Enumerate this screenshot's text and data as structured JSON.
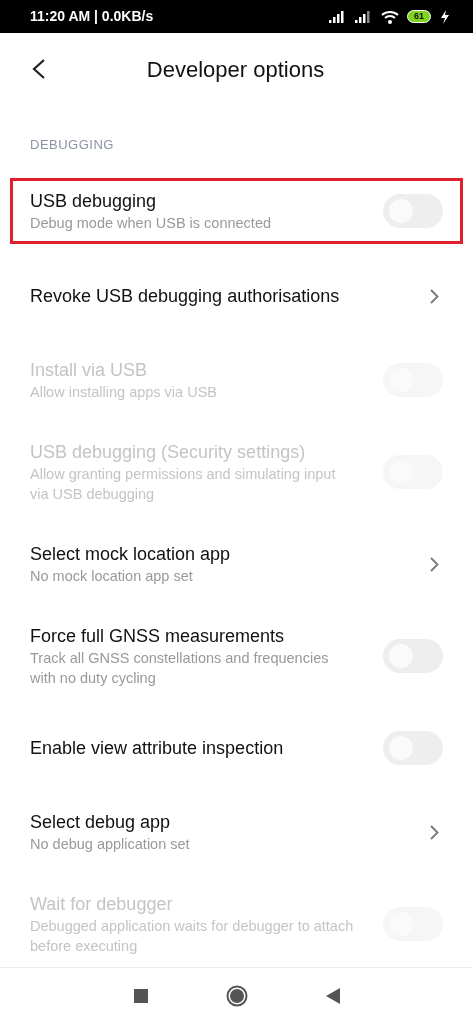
{
  "status_bar": {
    "time": "11:20 AM | 0.0KB/s",
    "battery": "61",
    "charging": true
  },
  "header": {
    "title": "Developer options"
  },
  "section": {
    "label": "DEBUGGING"
  },
  "items": [
    {
      "kind": "toggle",
      "title": "USB debugging",
      "subtitle": "Debug mode when USB is connected",
      "on": false,
      "disabled": false,
      "highlighted": true
    },
    {
      "kind": "link",
      "title": "Revoke USB debugging authorisations",
      "disabled": false,
      "highlighted": false
    },
    {
      "kind": "toggle",
      "title": "Install via USB",
      "subtitle": "Allow installing apps via USB",
      "on": false,
      "disabled": true,
      "highlighted": false
    },
    {
      "kind": "toggle",
      "title": "USB debugging (Security settings)",
      "subtitle": "Allow granting permissions and simulating input via USB debugging",
      "on": false,
      "disabled": true,
      "highlighted": false
    },
    {
      "kind": "link",
      "title": "Select mock location app",
      "subtitle": "No mock location app set",
      "disabled": false,
      "highlighted": false
    },
    {
      "kind": "toggle",
      "title": "Force full GNSS measurements",
      "subtitle": "Track all GNSS constellations and frequencies with no duty cycling",
      "on": false,
      "disabled": false,
      "highlighted": false
    },
    {
      "kind": "toggle",
      "title": "Enable view attribute inspection",
      "on": false,
      "disabled": false,
      "highlighted": false
    },
    {
      "kind": "link",
      "title": "Select debug app",
      "subtitle": "No debug application set",
      "disabled": false,
      "highlighted": false
    },
    {
      "kind": "toggle",
      "title": "Wait for debugger",
      "subtitle": "Debugged application waits for debugger to attach before executing",
      "on": false,
      "disabled": true,
      "highlighted": false
    }
  ]
}
